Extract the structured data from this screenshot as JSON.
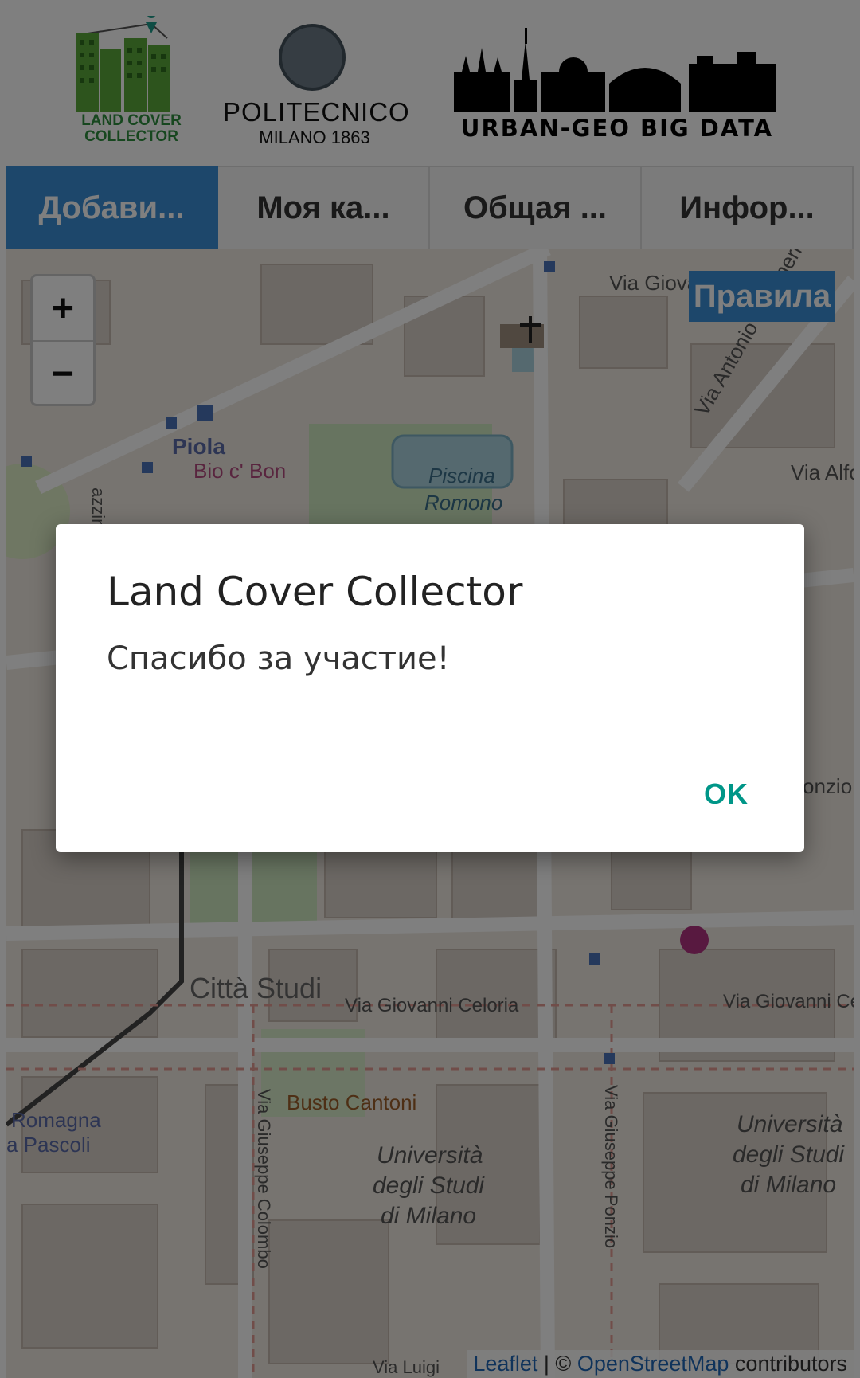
{
  "header": {
    "lcc_logo": {
      "line1": "LAND COVER",
      "line2": "COLLECTOR"
    },
    "poli_logo": {
      "name": "POLITECNICO",
      "sub": "MILANO 1863"
    },
    "urban_logo": {
      "text": "URBAN-GEO BIG DATA"
    }
  },
  "tabs": [
    {
      "label": "Добави...",
      "active": true
    },
    {
      "label": "Моя ка..."
    },
    {
      "label": "Общая ..."
    },
    {
      "label": "Инфор..."
    }
  ],
  "map": {
    "zoom_in": "+",
    "zoom_out": "−",
    "rules_label": "Правила",
    "labels": {
      "via_giova": "Via Giova",
      "via_vallisneri": "Via Antonio Vallisneri",
      "via_alfo": "Via Alfo",
      "piola": "Piola",
      "bio_bon": "Bio c' Bon",
      "piscina1": "Piscina",
      "piscina2": "Romono",
      "citta_studi": "Città Studi",
      "celoria": "Via Giovanni Celoria",
      "via_giovanni_c": "Via Giovanni Ce",
      "busto": "Busto Cantoni",
      "romagna": "Romagna",
      "pascoli": "a Pascoli",
      "univ1_a": "Università",
      "univ1_b": "degli Studi",
      "univ1_c": "di Milano",
      "univ2_a": "Università",
      "univ2_b": "degli Studi",
      "univ2_c": "di Milano",
      "colombo": "Via Giuseppe Colombo",
      "ponzio": "Via Giuseppe Ponzio",
      "onzio": "onzio",
      "mazzini": "azzini",
      "via_luigi": "Via Luigi"
    },
    "attribution": {
      "leaflet": "Leaflet",
      "sep": " | © ",
      "osm": "OpenStreetMap",
      "contrib": " contributors"
    }
  },
  "dialog": {
    "title": "Land Cover Collector",
    "message": "Спасибо за участие!",
    "ok": "OK"
  },
  "colors": {
    "accent_blue": "#3a8fd6",
    "ok_teal": "#009688",
    "lcc_green": "#2f8f3f"
  }
}
